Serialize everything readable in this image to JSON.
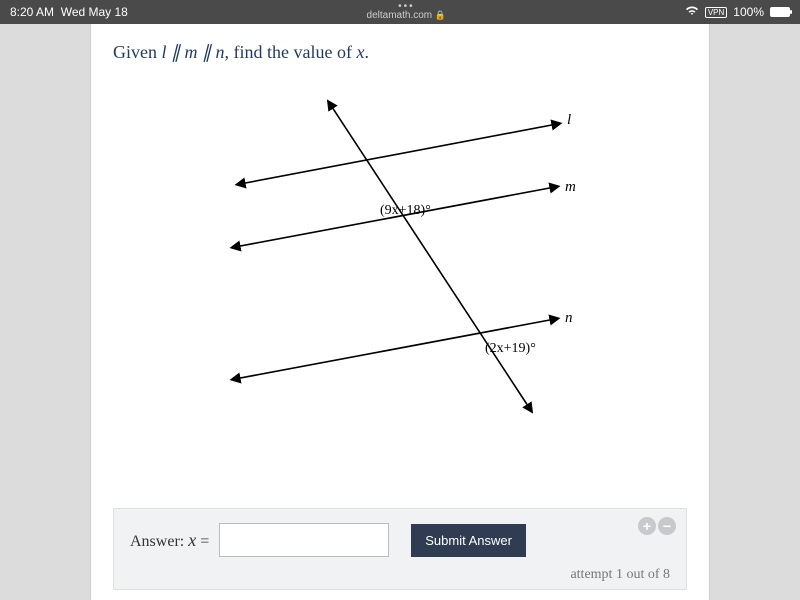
{
  "status": {
    "time": "8:20 AM",
    "date": "Wed May 18",
    "domain": "deltamath.com",
    "vpn": "VPN",
    "battery_pct": "100%"
  },
  "question": {
    "prefix": "Given ",
    "cond": "l ∥ m ∥ n",
    "suffix": ", find the value of ",
    "var": "x",
    "end": "."
  },
  "diagram": {
    "line_l": "l",
    "line_m": "m",
    "line_n": "n",
    "angle1": "(9x+18)°",
    "angle2": "(2x+19)°"
  },
  "answer": {
    "label_prefix": "Answer:  ",
    "var": "x",
    "equals": " =",
    "value": "",
    "submit": "Submit Answer",
    "attempt": "attempt 1 out of 8"
  }
}
